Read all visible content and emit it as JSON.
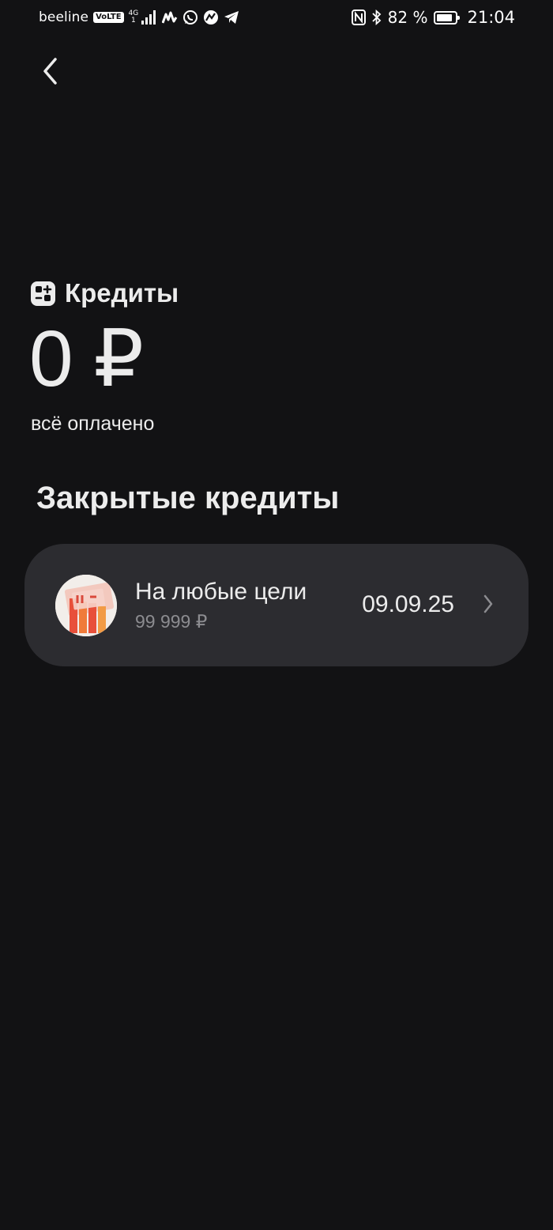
{
  "status_bar": {
    "carrier": "beeline",
    "volte": "VoLTE",
    "network_type": "4G",
    "network_sub": "1",
    "battery_percent": "82 %",
    "battery_level": 0.82,
    "time": "21:04"
  },
  "header": {
    "back_icon": "chevron-left-icon"
  },
  "credits": {
    "title": "Кредиты",
    "icon": "credits-grid-icon",
    "balance": "0 ₽",
    "status": "всё оплачено"
  },
  "closed_credits": {
    "title": "Закрытые кредиты",
    "items": [
      {
        "name": "На любые цели",
        "amount": "99 999 ₽",
        "date": "09.09.25",
        "thumbnail": "money-illustration",
        "chevron": "chevron-right-icon"
      }
    ]
  },
  "colors": {
    "background": "#121214",
    "card": "#2C2C30",
    "text_primary": "#ECECEC",
    "text_secondary": "#8C8C90"
  }
}
